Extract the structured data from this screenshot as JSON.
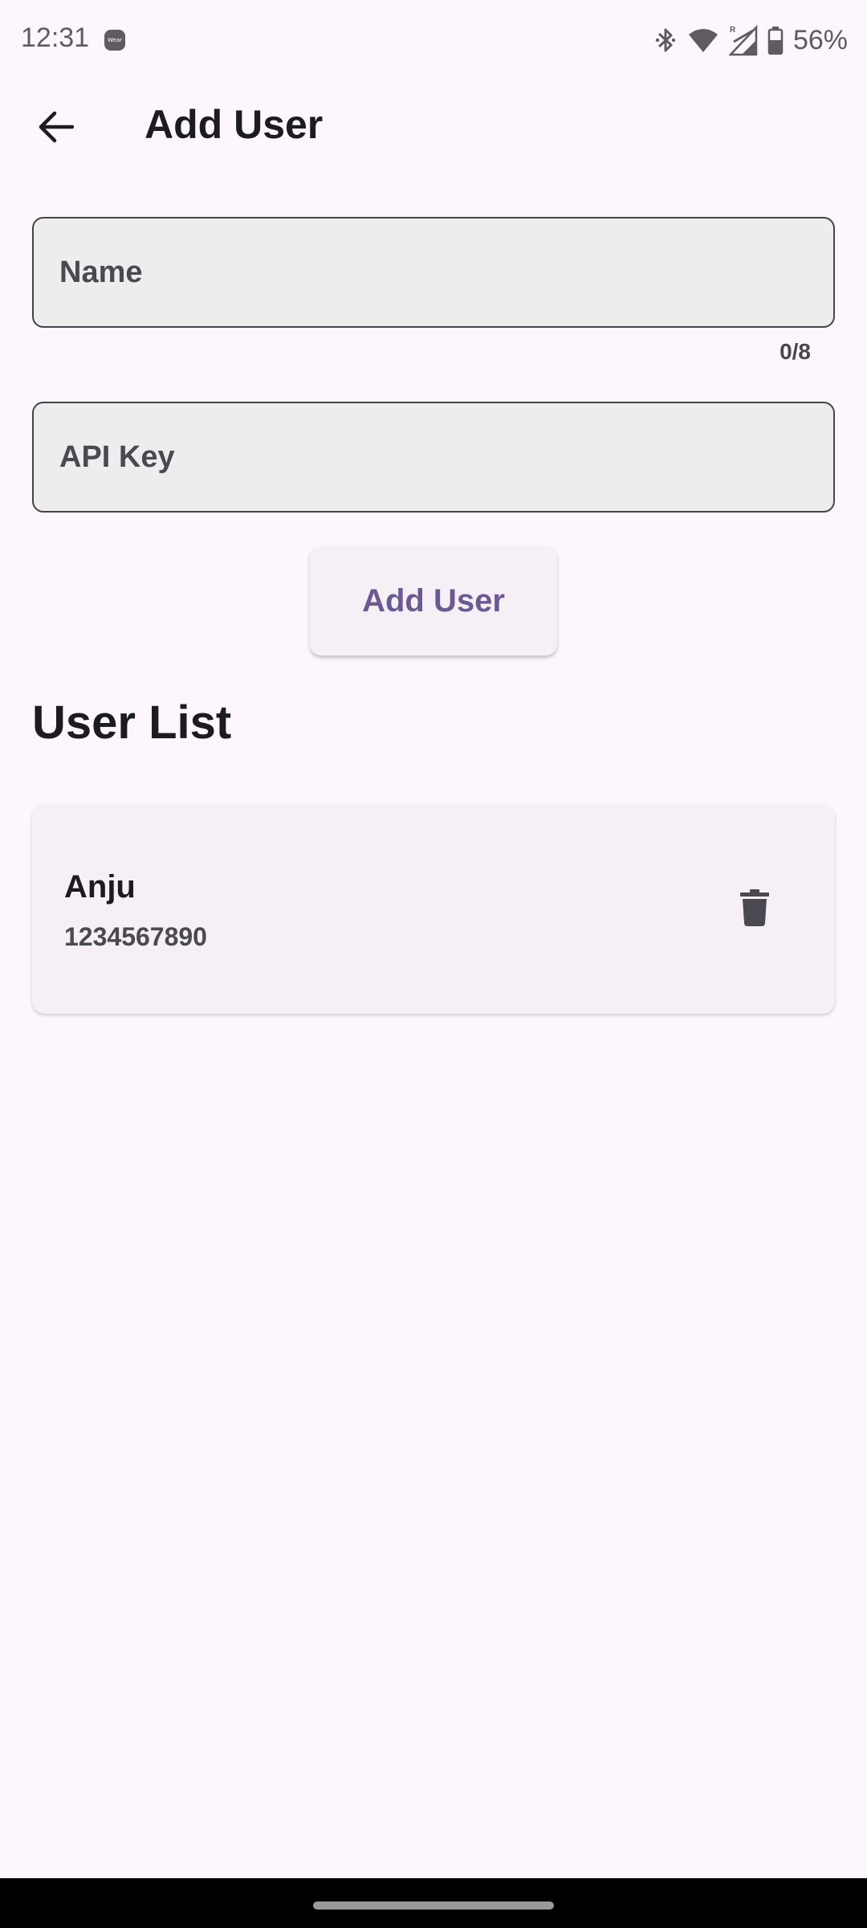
{
  "status_bar": {
    "time": "12:31",
    "wear_badge": "Wear",
    "battery": "56%",
    "icons": [
      "bluetooth-icon",
      "wifi-icon",
      "signal-roaming-icon",
      "battery-icon"
    ]
  },
  "app_bar": {
    "back_icon": "arrow-back-icon",
    "title": "Add User"
  },
  "form": {
    "name_placeholder": "Name",
    "name_value": "",
    "name_counter": "0/8",
    "api_key_placeholder": "API Key",
    "api_key_value": "",
    "submit_label": "Add User"
  },
  "user_list": {
    "title": "User List",
    "users": [
      {
        "name": "Anju",
        "api_key": "1234567890",
        "action_icon": "trash-icon"
      }
    ]
  },
  "colors": {
    "background": "#fdf6fc",
    "accent": "#6b5a92",
    "field_background": "#eeedee",
    "card_background": "#f6f0f6"
  }
}
